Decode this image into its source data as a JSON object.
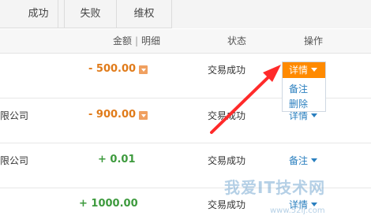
{
  "tabs": [
    {
      "label": ""
    },
    {
      "label": "成功"
    },
    {
      "label": "失败"
    },
    {
      "label": "维权"
    }
  ],
  "header": {
    "amount": "金额",
    "separator": "|",
    "detail": "明细",
    "status": "状态",
    "action": "操作"
  },
  "rows": [
    {
      "party": "",
      "amount": "- 500.00",
      "status": "交易成功",
      "action": "详情",
      "has_detail_toggle": true
    },
    {
      "party": "限公司",
      "amount": "- 900.00",
      "status": "交易成功",
      "action": "详情",
      "has_detail_toggle": true
    },
    {
      "party": "限公司",
      "amount": "+ 0.01",
      "status": "交易成功",
      "action": "备注",
      "has_detail_toggle": false
    },
    {
      "party": "",
      "amount": "+ 1000.00",
      "status": "交易成功",
      "action": "详情",
      "has_detail_toggle": false
    }
  ],
  "dropdown": {
    "active": "详情",
    "items": [
      "备注",
      "删除"
    ]
  },
  "colors": {
    "negative_amount": "#e07b1a",
    "positive_amount": "#3d9a3d",
    "link": "#2a7fbf",
    "highlight": "#ff8a00",
    "arrow": "#ff2a2a"
  },
  "watermark": {
    "main": "我爱IT技术网",
    "url": "www.52ij.com"
  }
}
